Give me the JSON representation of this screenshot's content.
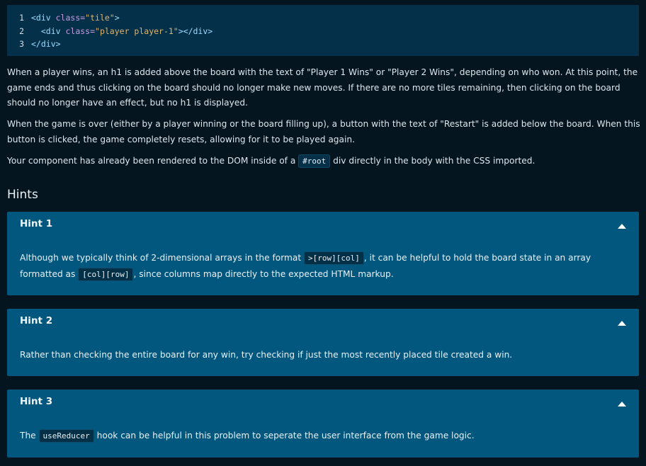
{
  "code": {
    "lines": [
      {
        "num": "1",
        "indent": "",
        "tag_open": "<div ",
        "attr": "class=",
        "str": "\"tile\"",
        "tag_close": ">"
      },
      {
        "num": "2",
        "indent": "  ",
        "tag_open": "<div ",
        "attr": "class=",
        "str": "\"player player-1\"",
        "tag_close": "></div>"
      },
      {
        "num": "3",
        "indent": "",
        "tag_open": "</div>",
        "attr": "",
        "str": "",
        "tag_close": ""
      }
    ]
  },
  "paragraphs": {
    "p1": "When a player wins, an h1 is added above the board with the text of \"Player 1 Wins\" or \"Player 2 Wins\", depending on who won. At this point, the game ends and thus clicking on the board should no longer make new moves. If there are no more tiles remaining, then clicking on the board should no longer have an effect, but no h1 is displayed.",
    "p2": "When the game is over (either by a player winning or the board filling up), a button with the text of \"Restart\" is added below the board. When this button is clicked, the game completely resets, allowing for it to be played again.",
    "p3_before": "Your component has already been rendered to the DOM inside of a ",
    "p3_code": "#root",
    "p3_after": " div directly in the body with the CSS imported."
  },
  "hints": {
    "title": "Hints",
    "items": [
      {
        "title": "Hint 1",
        "text_a": "Although we typically think of 2-dimensional arrays in the format ",
        "code_a": ">[row][col]",
        "text_b": ", it can be helpful to hold the board state in an array formatted as ",
        "code_b": "[col][row]",
        "text_c": ", since columns map directly to the expected HTML markup."
      },
      {
        "title": "Hint 2",
        "text_a": "Rather than checking the entire board for any win, try checking if just the most recently placed tile created a win."
      },
      {
        "title": "Hint 3",
        "text_a": "The ",
        "code_a": "useReducer",
        "text_b": " hook can be helpful in this problem to seperate the user interface from the game logic."
      }
    ]
  },
  "colors": {
    "background": "#041520",
    "code_bg": "#05304a",
    "hint_bg": "#02577f"
  }
}
